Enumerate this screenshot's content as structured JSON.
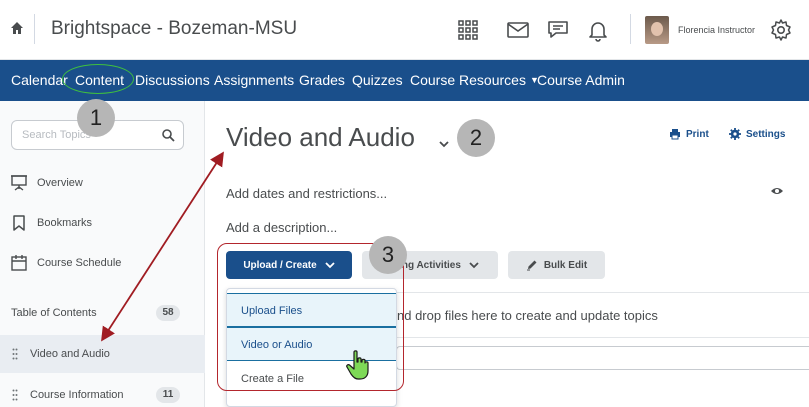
{
  "header": {
    "org_title": "Brightspace - Bozeman-MSU",
    "user_name": "Florencia Instructor"
  },
  "nav": {
    "items": [
      {
        "label": "Calendar"
      },
      {
        "label": "Content"
      },
      {
        "label": "Discussions"
      },
      {
        "label": "Assignments"
      },
      {
        "label": "Grades"
      },
      {
        "label": "Quizzes"
      },
      {
        "label": "Course Resources"
      },
      {
        "label": "Course Admin"
      }
    ]
  },
  "sidebar": {
    "search_placeholder": "Search Topics",
    "items": [
      {
        "label": "Overview"
      },
      {
        "label": "Bookmarks"
      },
      {
        "label": "Course Schedule"
      }
    ],
    "toc_label": "Table of Contents",
    "toc_count": "58",
    "modules": [
      {
        "label": "Video and Audio",
        "count": ""
      },
      {
        "label": "Course Information",
        "count": "11"
      }
    ]
  },
  "main": {
    "title": "Video and Audio",
    "print_label": "Print",
    "settings_label": "Settings",
    "dates_link": "Add dates and restrictions...",
    "description_link": "Add a description...",
    "upload_button": "Upload / Create",
    "activities_button": "ing Activities",
    "bulk_edit_button": "Bulk Edit",
    "drop_text": "nd drop files here to create and update topics"
  },
  "menu": {
    "items": [
      {
        "label": "Upload Files"
      },
      {
        "label": "Video or Audio"
      },
      {
        "label": "Create a File"
      }
    ]
  },
  "callouts": {
    "one": "1",
    "two": "2",
    "three": "3"
  },
  "colors": {
    "navbar": "#1a4f8b",
    "primary_button": "#1a4f8b",
    "callout_box": "#b3262d",
    "highlight_ring": "#3fbf3f",
    "arrow": "#a01c22"
  }
}
